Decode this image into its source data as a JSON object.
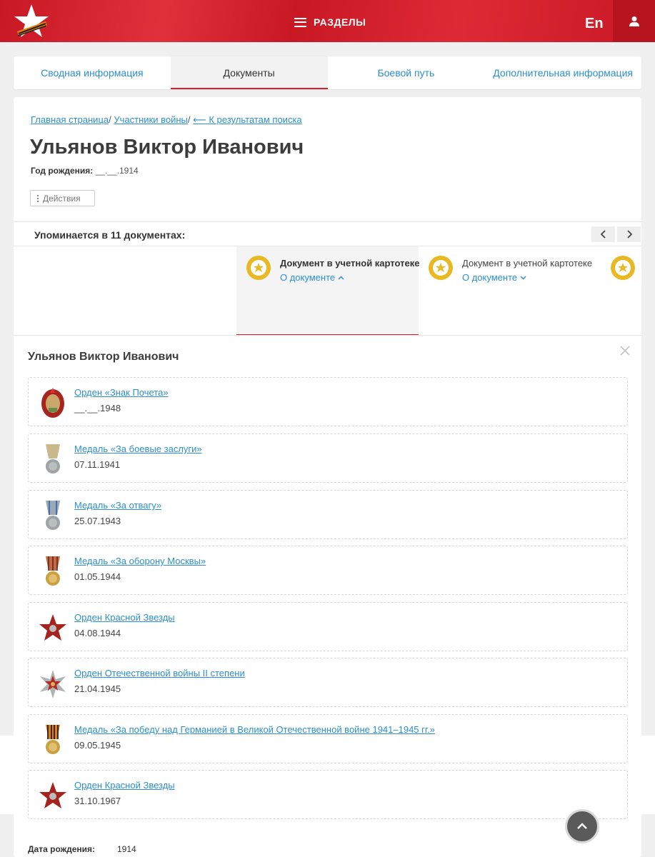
{
  "header": {
    "menu_label": "РАЗДЕЛЫ",
    "lang_label": "En",
    "brand_color": "#d51f2c"
  },
  "tabs": [
    {
      "label": "Сводная информация",
      "active": false
    },
    {
      "label": "Документы",
      "active": true
    },
    {
      "label": "Боевой путь",
      "active": false
    },
    {
      "label": "Дополнительная информация",
      "active": false
    }
  ],
  "breadcrumb": {
    "home": "Главная страница",
    "participants": "Участники войны",
    "back": "⟵ К результатам поиска"
  },
  "person": {
    "name": "Ульянов Виктор Иванович",
    "birth_label": "Год рождения:",
    "birth_value": "__.__.1914"
  },
  "actions_label": "Действия",
  "documents": {
    "title": "Упоминается в 11 документах:",
    "cards": [
      {
        "title": "Документ в учетной картотеке",
        "link": "О документе",
        "active": true
      },
      {
        "title": "Документ в учетной картотеке",
        "link": "О документе",
        "active": false
      }
    ]
  },
  "detail": {
    "name": "Ульянов Виктор Иванович",
    "awards": [
      {
        "title": "Орден «Знак Почета»",
        "date": "__.__.1948",
        "icon": "badge-of-honor-icon"
      },
      {
        "title": "Медаль «За боевые заслуги»",
        "date": "07.11.1941",
        "icon": "combat-merit-medal-icon"
      },
      {
        "title": "Медаль «За отвагу»",
        "date": "25.07.1943",
        "icon": "courage-medal-icon"
      },
      {
        "title": "Медаль «За оборону Москвы»",
        "date": "01.05.1944",
        "icon": "moscow-defense-medal-icon"
      },
      {
        "title": "Орден Красной Звезды",
        "date": "04.08.1944",
        "icon": "red-star-order-icon"
      },
      {
        "title": "Орден Отечественной войны II степени",
        "date": "21.04.1945",
        "icon": "patriotic-war-order-icon"
      },
      {
        "title": "Медаль «За победу над Германией в Великой Отечественной войне 1941–1945 гг.»",
        "date": "09.05.1945",
        "icon": "victory-medal-icon"
      },
      {
        "title": "Орден Красной Звезды",
        "date": "31.10.1967",
        "icon": "red-star-order-icon"
      }
    ],
    "dob_label": "Дата рождения:",
    "dob_value": "1914"
  }
}
